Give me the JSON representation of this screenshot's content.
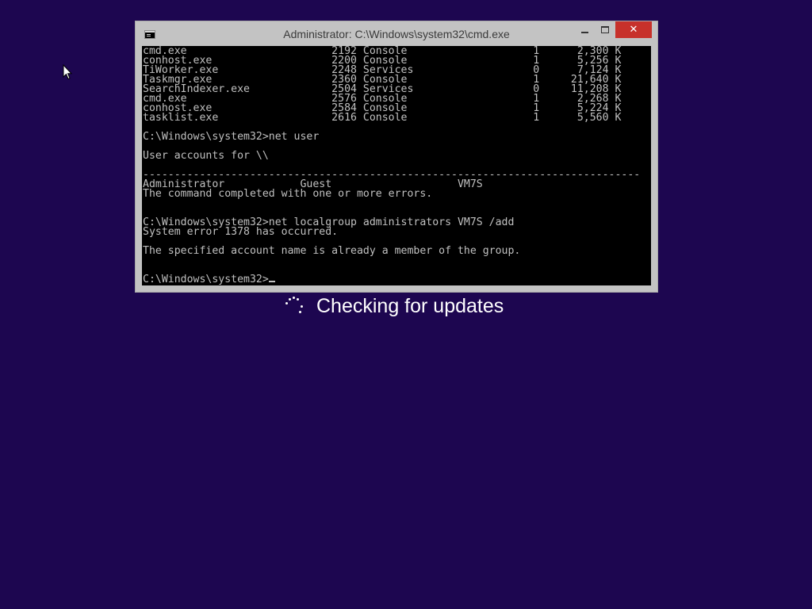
{
  "window": {
    "title": "Administrator: C:\\Windows\\system32\\cmd.exe",
    "close_glyph": "✕"
  },
  "console": {
    "text": "cmd.exe                       2192 Console                    1      2,300 K\nconhost.exe                   2200 Console                    1      5,256 K\nTiWorker.exe                  2248 Services                   0      7,124 K\nTaskmgr.exe                   2360 Console                    1     21,640 K\nSearchIndexer.exe             2504 Services                   0     11,208 K\ncmd.exe                       2576 Console                    1      2,268 K\nconhost.exe                   2584 Console                    1      5,224 K\ntasklist.exe                  2616 Console                    1      5,560 K\n\nC:\\Windows\\system32>net user\n\nUser accounts for \\\\\n\n-------------------------------------------------------------------------------\nAdministrator            Guest                    VM7S\nThe command completed with one or more errors.\n\n\nC:\\Windows\\system32>net localgroup administrators VM7S /add\nSystem error 1378 has occurred.\n\nThe specified account name is already a member of the group.\n\n\nC:\\Windows\\system32>"
  },
  "update_status": {
    "label": "Checking for updates"
  },
  "colors": {
    "desktop_background": "#1d0650",
    "console_background": "#000000",
    "console_text": "#c0c0c0",
    "close_button": "#c7312b"
  }
}
